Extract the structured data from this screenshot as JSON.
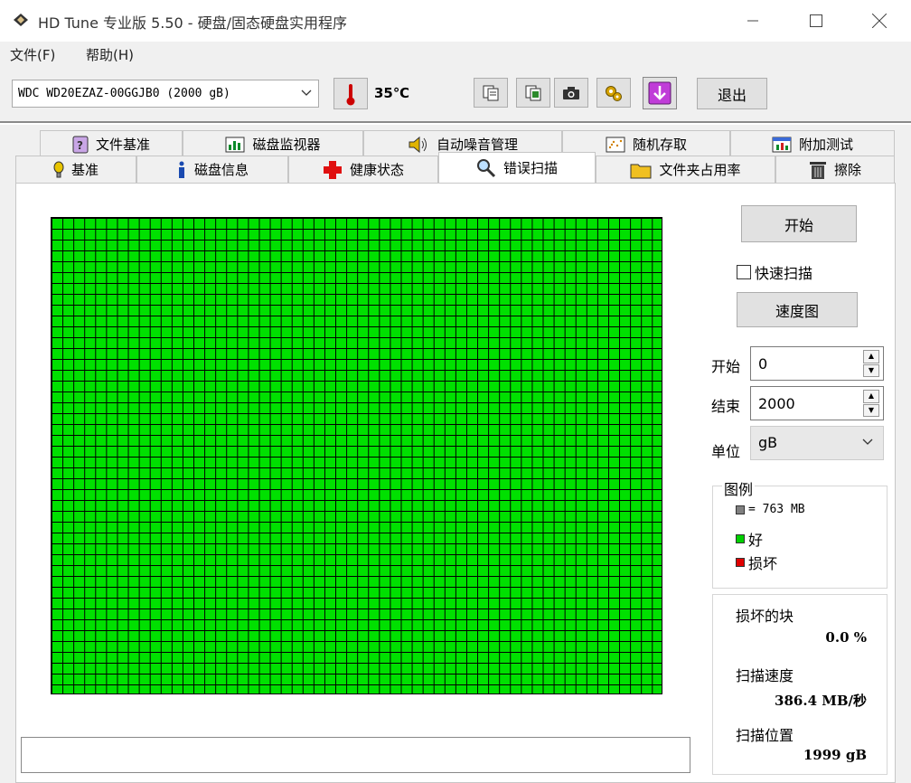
{
  "window": {
    "title": "HD Tune 专业版 5.50 - 硬盘/固态硬盘实用程序",
    "icon": "hd-tune-app-icon"
  },
  "menu": {
    "file": "文件(F)",
    "help": "帮助(H)"
  },
  "toolbar": {
    "drive": "WDC WD20EZAZ-00GGJB0 (2000 gB)",
    "temperature": "35℃",
    "exit_label": "退出"
  },
  "tabs": {
    "row1": [
      {
        "label": "文件基准",
        "icon": "file-benchmark-icon"
      },
      {
        "label": "磁盘监视器",
        "icon": "disk-monitor-icon"
      },
      {
        "label": "自动噪音管理",
        "icon": "speaker-icon"
      },
      {
        "label": "随机存取",
        "icon": "random-access-icon"
      },
      {
        "label": "附加测试",
        "icon": "extra-tests-icon"
      }
    ],
    "row2": [
      {
        "label": "基准",
        "icon": "benchmark-icon"
      },
      {
        "label": "磁盘信息",
        "icon": "info-icon"
      },
      {
        "label": "健康状态",
        "icon": "health-cross-icon"
      },
      {
        "label": "错误扫描",
        "icon": "magnifier-icon",
        "active": true
      },
      {
        "label": "文件夹占用率",
        "icon": "folder-icon"
      },
      {
        "label": "擦除",
        "icon": "trash-icon"
      }
    ]
  },
  "scan": {
    "start_button": "开始",
    "quick_scan_label": "快速扫描",
    "quick_scan_checked": false,
    "speed_map_button": "速度图",
    "start_label": "开始",
    "start_value": "0",
    "end_label": "结束",
    "end_value": "2000",
    "unit_label": "单位",
    "unit_value": "gB",
    "grid_color_good": "#00e000"
  },
  "legend": {
    "title": "图例",
    "block_size": "= 763 MB",
    "good": "好",
    "bad": "损坏",
    "colors": {
      "block": "#808080",
      "good": "#00d000",
      "bad": "#e00000"
    }
  },
  "stats": {
    "damaged_label": "损坏的块",
    "damaged_value": "0.0 %",
    "speed_label": "扫描速度",
    "speed_value": "386.4 MB/秒",
    "position_label": "扫描位置",
    "position_value": "1999 gB"
  }
}
